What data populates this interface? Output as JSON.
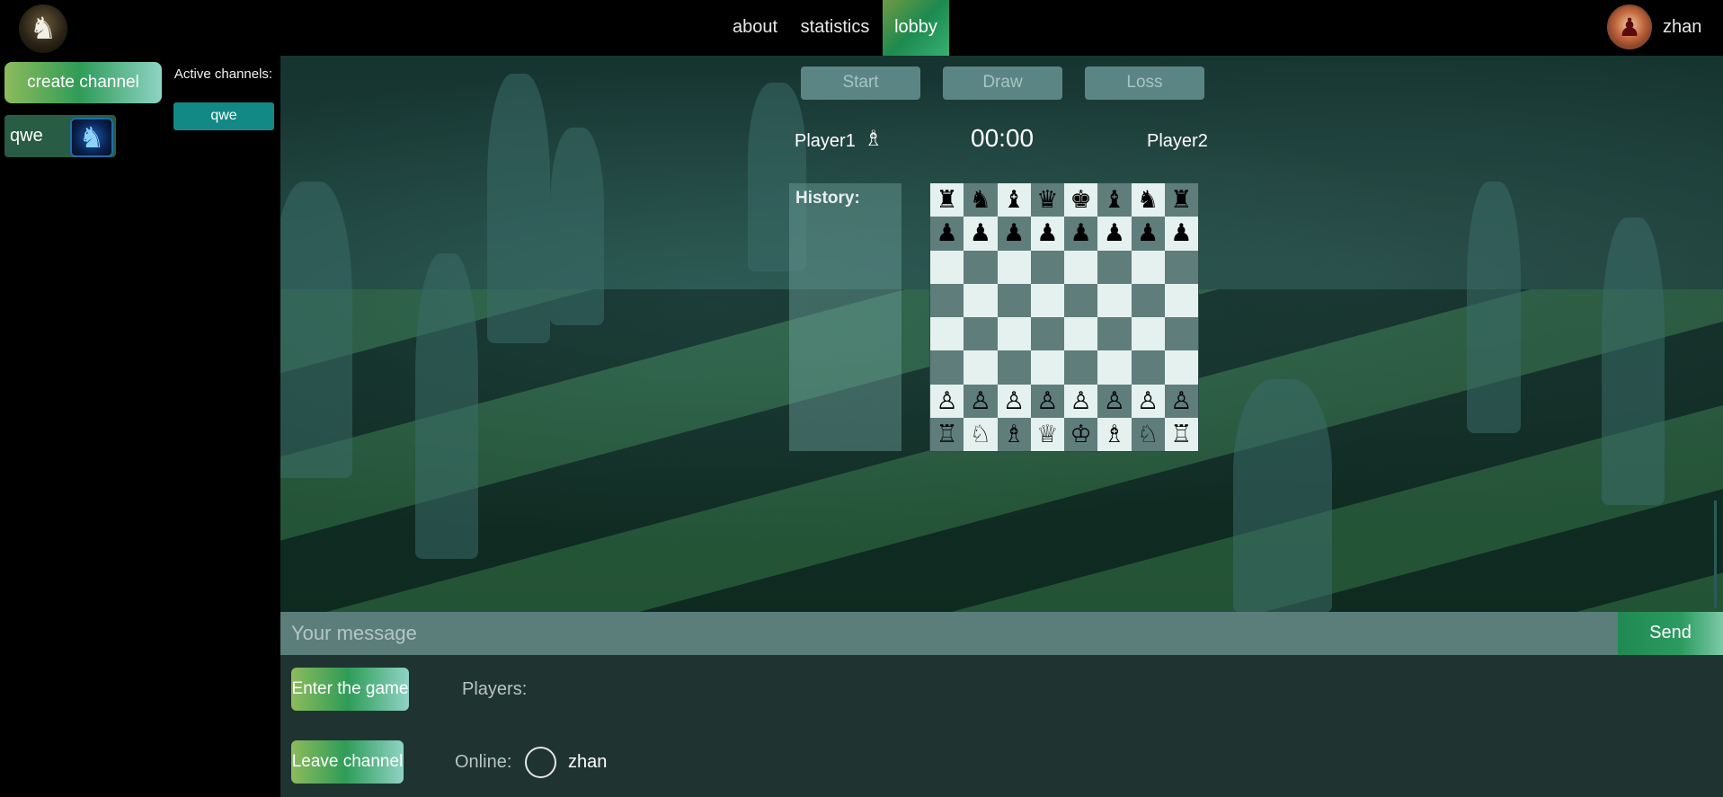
{
  "nav": {
    "items": [
      {
        "label": "about"
      },
      {
        "label": "statistics"
      },
      {
        "label": "lobby",
        "active": true
      }
    ],
    "username": "zhan",
    "logo_icon": "chess-knight-logo-icon",
    "avatar_icon": "user-avatar-icon"
  },
  "sidebar": {
    "create_label": "create channel",
    "active_label": "Active channels:",
    "active_channels": [
      "qwe"
    ],
    "channel": {
      "name": "qwe",
      "icon": "knight-icon"
    }
  },
  "game": {
    "buttons": {
      "start": "Start",
      "draw": "Draw",
      "loss": "Loss"
    },
    "player1": "Player1",
    "player2": "Player2",
    "turn_icon": "bishop-icon",
    "timer": "00:00",
    "history_label": "History:",
    "board": [
      [
        "♜",
        "♞",
        "♝",
        "♛",
        "♚",
        "♝",
        "♞",
        "♜"
      ],
      [
        "♟",
        "♟",
        "♟",
        "♟",
        "♟",
        "♟",
        "♟",
        "♟"
      ],
      [
        "",
        "",
        "",
        "",
        "",
        "",
        "",
        ""
      ],
      [
        "",
        "",
        "",
        "",
        "",
        "",
        "",
        ""
      ],
      [
        "",
        "",
        "",
        "",
        "",
        "",
        "",
        ""
      ],
      [
        "",
        "",
        "",
        "",
        "",
        "",
        "",
        ""
      ],
      [
        "♙",
        "♙",
        "♙",
        "♙",
        "♙",
        "♙",
        "♙",
        "♙"
      ],
      [
        "♖",
        "♘",
        "♗",
        "♕",
        "♔",
        "♗",
        "♘",
        "♖"
      ]
    ]
  },
  "chat": {
    "placeholder": "Your message",
    "send_label": "Send"
  },
  "lobby": {
    "enter_label": "Enter the game",
    "players_label": "Players:",
    "leave_label": "Leave channel",
    "online_label": "Online:",
    "online_users": [
      "zhan"
    ]
  },
  "colors": {
    "accent_green": "#2f9c58",
    "active_chip": "#138985",
    "board_light": "#e5f1ef",
    "board_dark": "#5f7d7b",
    "chat_bar": "#5b7e7b",
    "panel": "#1f3430"
  }
}
